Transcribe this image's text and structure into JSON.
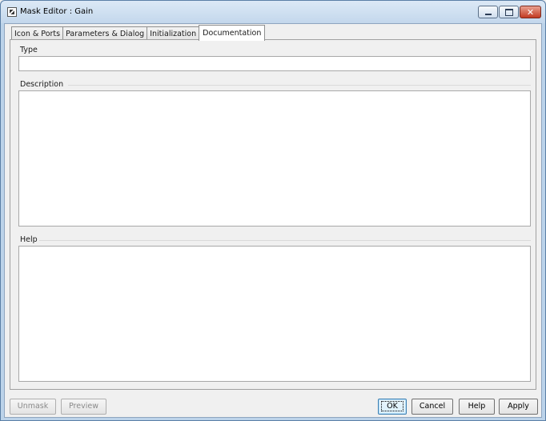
{
  "window": {
    "title": "Mask Editor : Gain"
  },
  "tabs": [
    {
      "label": "Icon & Ports"
    },
    {
      "label": "Parameters & Dialog"
    },
    {
      "label": "Initialization"
    },
    {
      "label": "Documentation"
    }
  ],
  "documentation": {
    "type_label": "Type",
    "type_value": "",
    "description_label": "Description",
    "description_value": "",
    "help_label": "Help",
    "help_value": ""
  },
  "buttons": {
    "unmask": "Unmask",
    "preview": "Preview",
    "ok": "OK",
    "cancel": "Cancel",
    "help": "Help",
    "apply": "Apply"
  },
  "icons": {
    "app": "mask-editor-icon",
    "minimize": "minimize-icon",
    "maximize": "maximize-icon",
    "close": "close-icon"
  },
  "colors": {
    "close_button": "#c23a22",
    "active_tab": "#ffffff"
  }
}
